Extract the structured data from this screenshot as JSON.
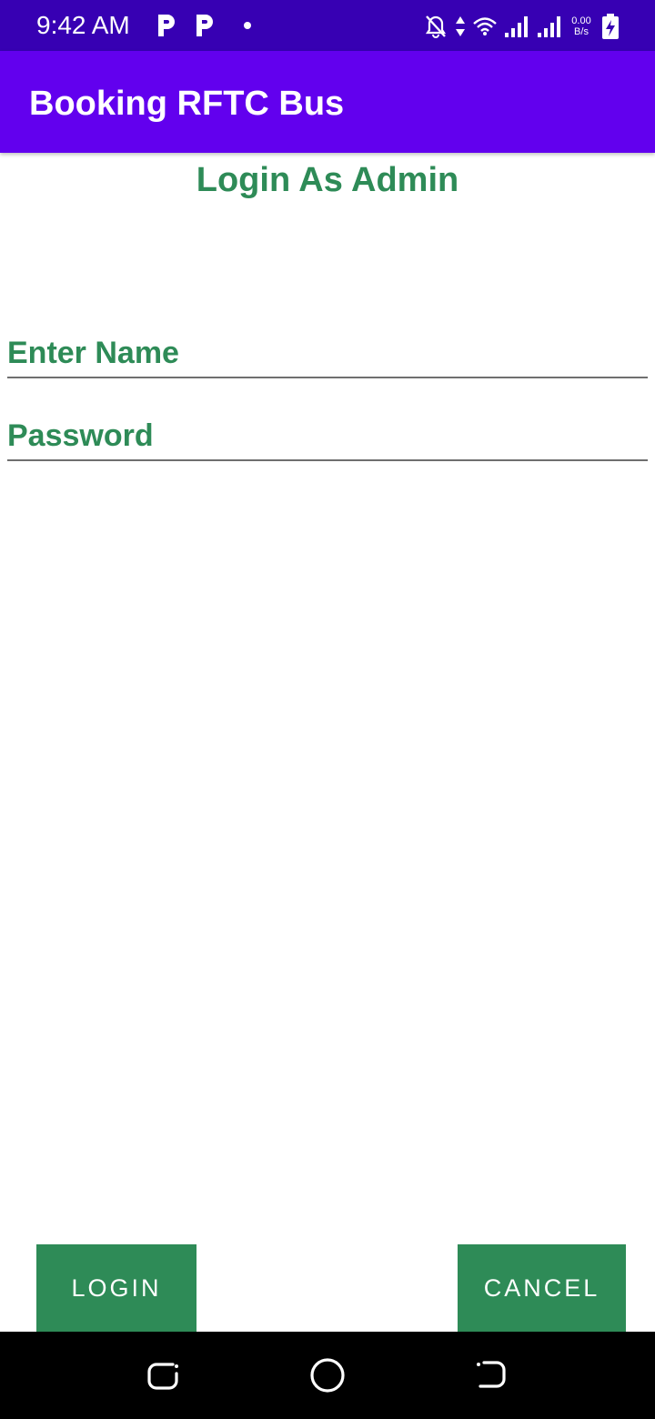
{
  "status_bar": {
    "time": "9:42 AM",
    "net_speed_value": "0.00",
    "net_speed_unit": "B/s",
    "icons": [
      "parking-icon",
      "parking-icon",
      "dot-icon",
      "mute-notification-icon",
      "data-arrows-icon",
      "wifi-icon",
      "signal-icon",
      "signal-icon",
      "battery-charging-icon"
    ]
  },
  "app_bar": {
    "title": "Booking RFTC Bus",
    "background": "#6200ee"
  },
  "page": {
    "heading": "Login As Admin",
    "accent_color": "#2e8b57"
  },
  "form": {
    "name_placeholder": "Enter Name",
    "name_value": "",
    "password_placeholder": "Password",
    "password_value": ""
  },
  "buttons": {
    "login_label": "LOGIN",
    "cancel_label": "CANCEL"
  },
  "nav_bar": {
    "icons": [
      "recent-apps-icon",
      "home-icon",
      "back-icon"
    ]
  }
}
